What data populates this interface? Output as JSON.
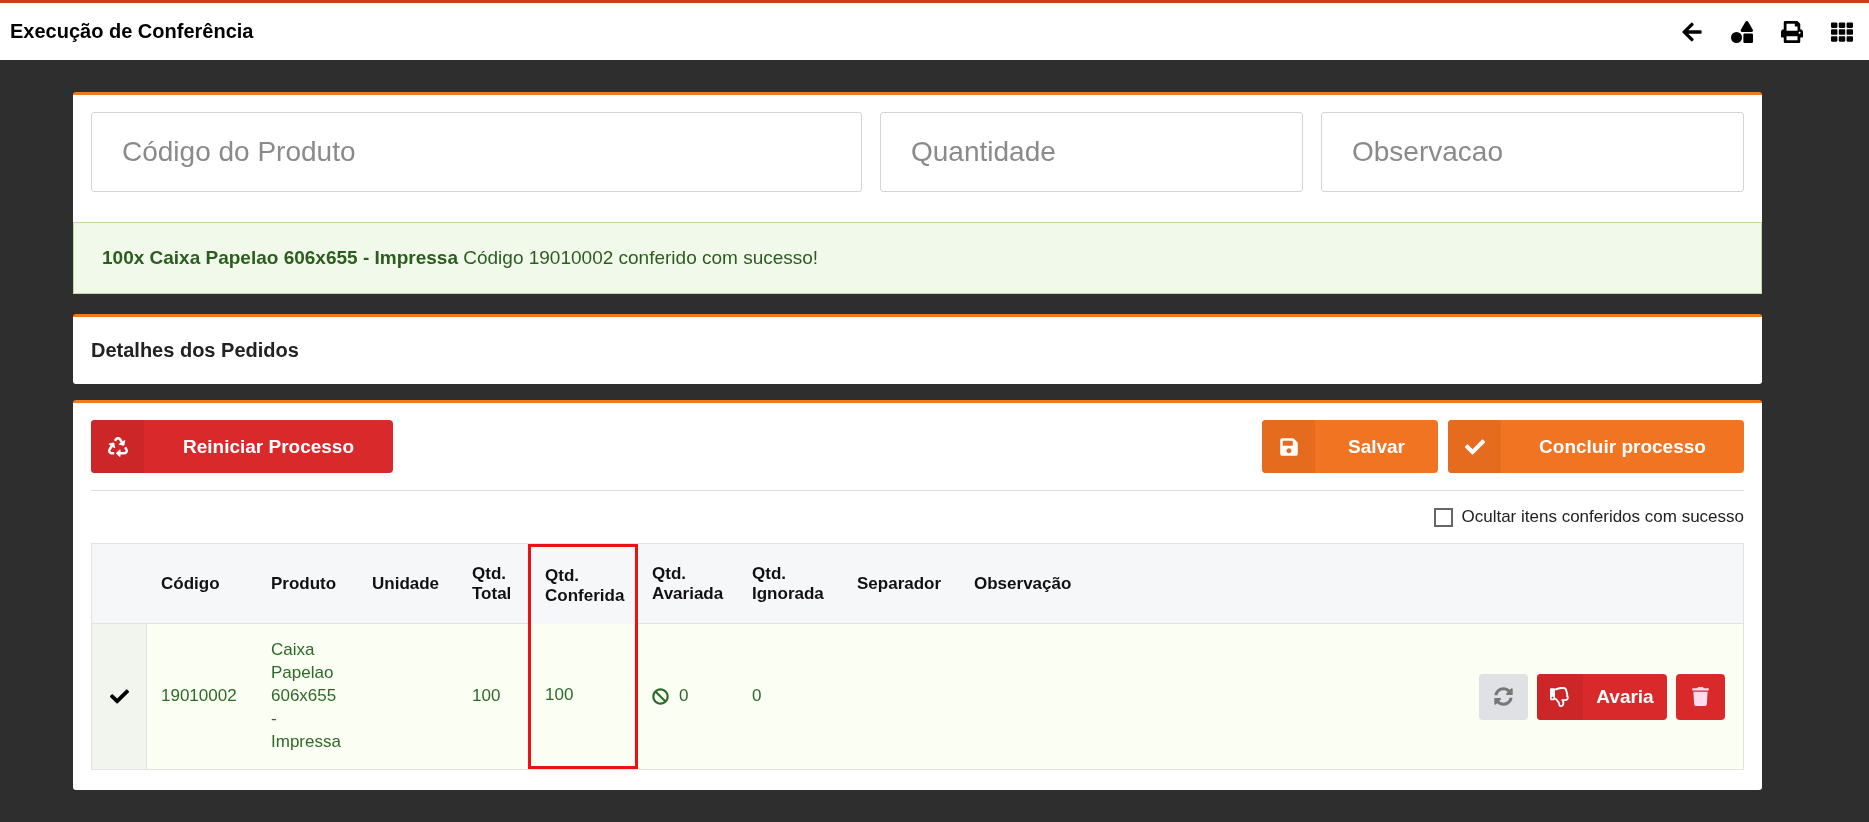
{
  "header": {
    "title": "Execução de Conferência"
  },
  "fields": [
    {
      "placeholder": "Código do Produto"
    },
    {
      "placeholder": "Quantidade"
    },
    {
      "placeholder": "Observacao"
    }
  ],
  "alert": {
    "text": "**100x Caixa Papelao 606x655 - Impressa** Código 19010002 conferido com sucesso!"
  },
  "details_panel": {
    "title": "Detalhes dos Pedidos"
  },
  "actions": {
    "restart": "Reiniciar Processo",
    "save": "Salvar",
    "finish": "Concluir processo"
  },
  "hide_checkbox": {
    "label": "Ocultar itens conferidos com sucesso",
    "checked": false
  },
  "table": {
    "columns": [
      {
        "label": "Código",
        "highlighted": false
      },
      {
        "label": "Produto",
        "highlighted": false
      },
      {
        "label": "Unidade",
        "highlighted": false
      },
      {
        "label": "Qtd. Total",
        "highlighted": false
      },
      {
        "label": "Qtd. Conferida",
        "highlighted": true
      },
      {
        "label": "Qtd. Avariada",
        "highlighted": false
      },
      {
        "label": "Qtd. Ignorada",
        "highlighted": false
      },
      {
        "label": "Separador",
        "highlighted": false
      },
      {
        "label": "Observação",
        "highlighted": false
      }
    ],
    "rows": [
      {
        "checked": true,
        "cells": [
          "19010002",
          "Caixa Papelao 606x655 - Impressa",
          "",
          "100",
          "100",
          "0",
          "0",
          "",
          ""
        ],
        "damage_button": "Avaria"
      }
    ]
  }
}
